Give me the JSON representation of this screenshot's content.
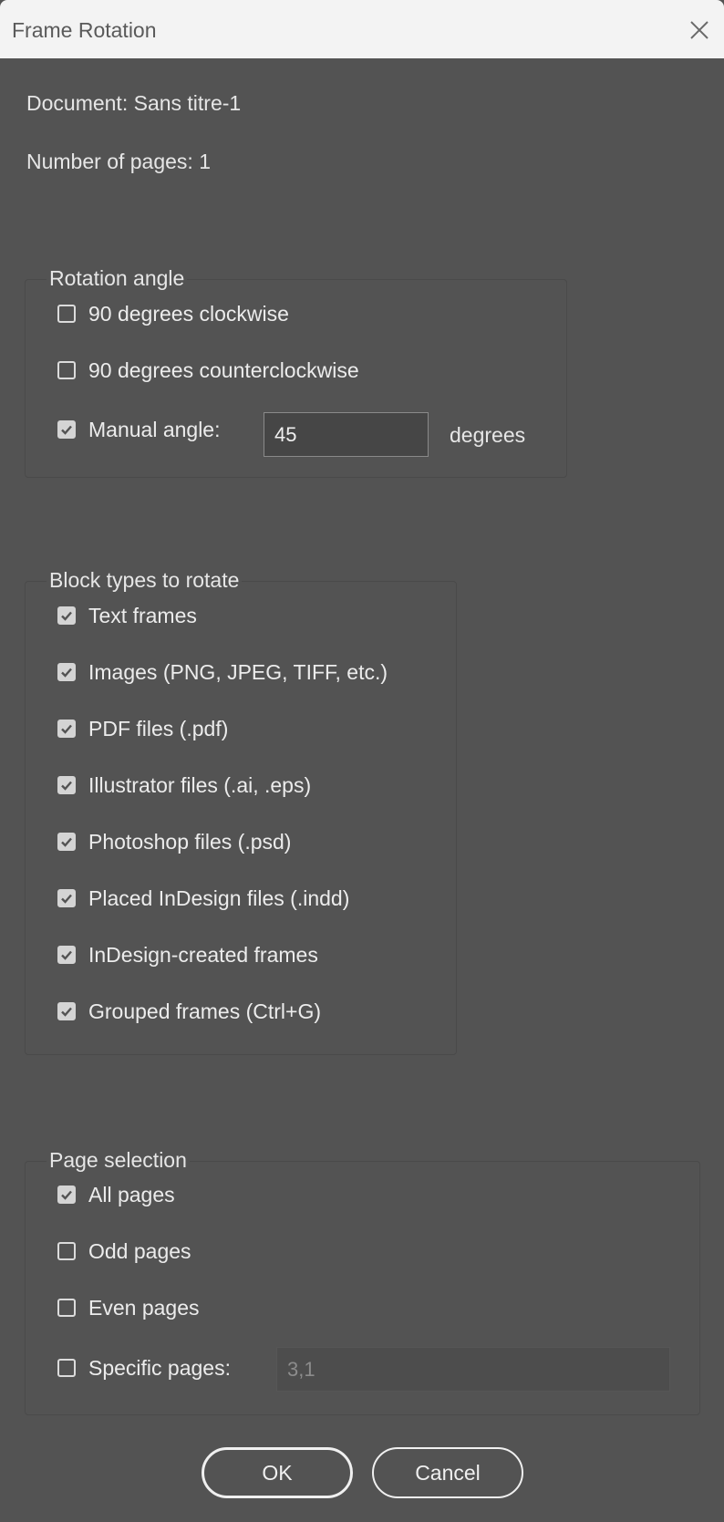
{
  "window": {
    "title": "Frame Rotation"
  },
  "info": {
    "document": "Document: Sans titre-1",
    "pages": "Number of pages: 1"
  },
  "rotation": {
    "legend": "Rotation angle",
    "options": [
      {
        "label": "90 degrees clockwise",
        "checked": false
      },
      {
        "label": "90 degrees counterclockwise",
        "checked": false
      },
      {
        "label": "Manual angle:",
        "checked": true
      }
    ],
    "manual_value": "45",
    "unit": "degrees"
  },
  "blocks": {
    "legend": "Block types to rotate",
    "items": [
      {
        "label": "Text frames",
        "checked": true
      },
      {
        "label": "Images (PNG, JPEG, TIFF, etc.)",
        "checked": true
      },
      {
        "label": "PDF files (.pdf)",
        "checked": true
      },
      {
        "label": "Illustrator files (.ai, .eps)",
        "checked": true
      },
      {
        "label": "Photoshop files (.psd)",
        "checked": true
      },
      {
        "label": "Placed InDesign files (.indd)",
        "checked": true
      },
      {
        "label": "InDesign-created frames",
        "checked": true
      },
      {
        "label": "Grouped frames (Ctrl+G)",
        "checked": true
      }
    ]
  },
  "pages": {
    "legend": "Page selection",
    "items": [
      {
        "label": "All pages",
        "checked": true
      },
      {
        "label": "Odd pages",
        "checked": false
      },
      {
        "label": "Even pages",
        "checked": false
      },
      {
        "label": "Specific pages:",
        "checked": false
      }
    ],
    "specific_value": "3,1"
  },
  "buttons": {
    "ok": "OK",
    "cancel": "Cancel"
  },
  "icons": {
    "close": "close-icon",
    "checkmark": "checkmark-icon"
  }
}
